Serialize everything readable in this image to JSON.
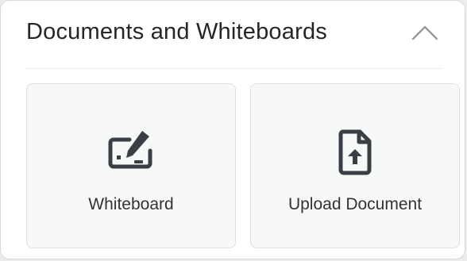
{
  "panel": {
    "title": "Documents and Whiteboards",
    "collapse_icon": "chevron-up-icon"
  },
  "cards": [
    {
      "label": "Whiteboard",
      "icon": "whiteboard-icon"
    },
    {
      "label": "Upload Document",
      "icon": "upload-document-icon"
    }
  ],
  "colors": {
    "icon": "#3a3f45",
    "text": "#262626",
    "card_bg": "#f7f8f8",
    "border": "#e0e0e0"
  }
}
